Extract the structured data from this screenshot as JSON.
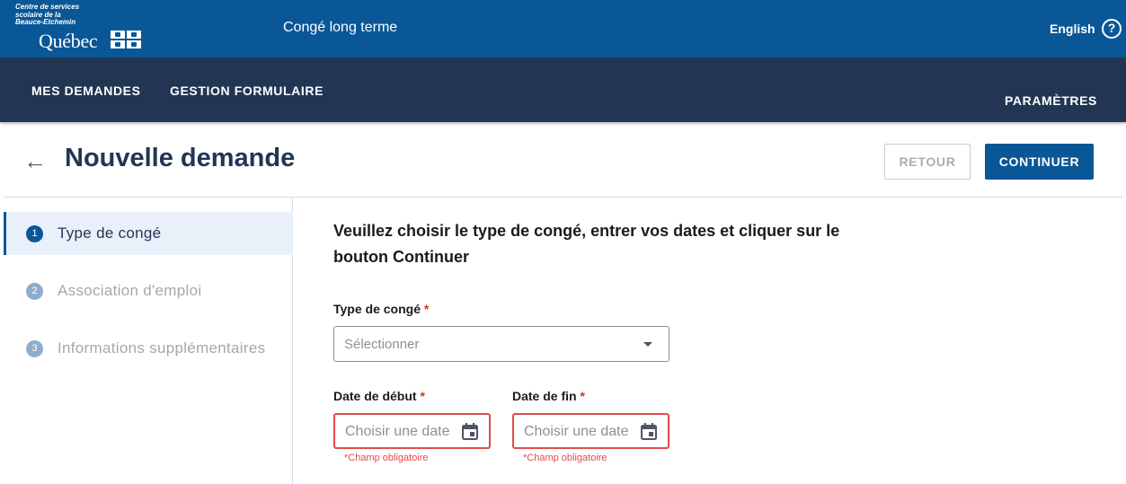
{
  "header": {
    "org_line1": "Centre de services",
    "org_line2": "scolaire de la",
    "org_line3": "Beauce-Etchemin",
    "quebec": "Québec",
    "app_title": "Congé long terme",
    "language": "English",
    "help": "?"
  },
  "nav": {
    "mes_demandes": "MES DEMANDES",
    "gestion_formulaire": "GESTION FORMULAIRE",
    "parametres": "PARAMÈTRES"
  },
  "page": {
    "back_icon": "←",
    "title": "Nouvelle demande",
    "retour_label": "RETOUR",
    "continuer_label": "CONTINUER"
  },
  "steps": [
    {
      "number": "1",
      "label": "Type de congé",
      "active": true
    },
    {
      "number": "2",
      "label": "Association d'emploi",
      "active": false
    },
    {
      "number": "3",
      "label": "Informations supplémentaires",
      "active": false
    }
  ],
  "form": {
    "instructions": "Veuillez choisir le type de congé, entrer vos dates et cliquer sur le bouton Continuer",
    "type_label": "Type de congé",
    "type_placeholder": "Sélectionner",
    "start_label": "Date de début",
    "end_label": "Date de fin",
    "date_placeholder": "Choisir une date",
    "required_mark": "*",
    "required_error": "*Champ obligatoire"
  },
  "colors": {
    "header_blue": "#095797",
    "nav_navy": "#223654",
    "error_red": "#e34a4a",
    "active_step_bg": "#eaf0fa"
  },
  "icons": {
    "back": "arrow-left-icon",
    "help": "question-circle-icon",
    "select_caret": "caret-down-icon",
    "date_picker": "calendar-icon",
    "flag": "fleurdelise-flag-icon"
  }
}
